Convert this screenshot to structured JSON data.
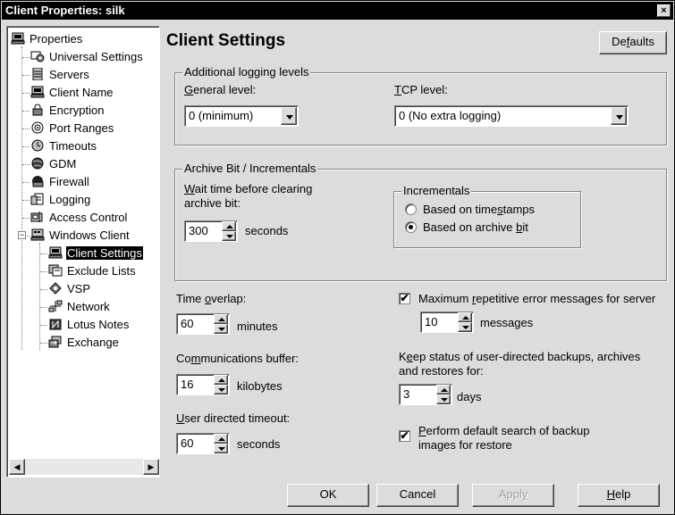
{
  "window": {
    "title": "Client Properties: silk",
    "close_glyph": "×"
  },
  "tree": {
    "root": {
      "label": "Properties",
      "icon": "computer-icon"
    },
    "items": [
      {
        "label": "Universal Settings",
        "icon": "gear-computer-icon"
      },
      {
        "label": "Servers",
        "icon": "server-icon"
      },
      {
        "label": "Client Name",
        "icon": "computer-icon"
      },
      {
        "label": "Encryption",
        "icon": "lock-icon"
      },
      {
        "label": "Port Ranges",
        "icon": "target-icon"
      },
      {
        "label": "Timeouts",
        "icon": "clock-icon"
      },
      {
        "label": "GDM",
        "icon": "globe-icon"
      },
      {
        "label": "Firewall",
        "icon": "firewall-icon"
      },
      {
        "label": "Logging",
        "icon": "log-icon"
      },
      {
        "label": "Access Control",
        "icon": "access-control-icon"
      },
      {
        "label": "Windows Client",
        "icon": "windows-client-icon",
        "expander": "−"
      }
    ],
    "children": [
      {
        "label": "Client Settings",
        "icon": "computer-icon",
        "selected": true
      },
      {
        "label": "Exclude Lists",
        "icon": "exclude-list-icon"
      },
      {
        "label": "VSP",
        "icon": "vsp-icon"
      },
      {
        "label": "Network",
        "icon": "network-icon"
      },
      {
        "label": "Lotus Notes",
        "icon": "lotus-notes-icon"
      },
      {
        "label": "Exchange",
        "icon": "exchange-icon"
      }
    ],
    "scroll_left": "◀",
    "scroll_right": "▶"
  },
  "panel": {
    "title": "Client Settings",
    "defaults_button": {
      "pre": "De",
      "key": "f",
      "post": "aults"
    },
    "logging": {
      "group_title": "Additional logging levels",
      "general_label": {
        "pre": "",
        "key": "G",
        "post": "eneral level:"
      },
      "general_value": "0  (minimum)",
      "tcp_label": {
        "pre": "",
        "key": "T",
        "post": "CP level:"
      },
      "tcp_value": "0 (No extra logging)"
    },
    "archive": {
      "group_title": "Archive Bit / Incrementals",
      "wait_label_line1": {
        "pre": "",
        "key": "W",
        "post": "ait time before clearing"
      },
      "wait_label_line2": "archive bit:",
      "wait_value": "300",
      "wait_unit": "seconds",
      "incrementals": {
        "title": "Incrementals",
        "options": [
          {
            "pre": "Based on time",
            "key": "s",
            "post": "tamps",
            "selected": false
          },
          {
            "pre": "Based on archive ",
            "key": "b",
            "post": "it",
            "selected": true
          }
        ]
      }
    },
    "time_overlap": {
      "label": {
        "pre": "Time ",
        "key": "o",
        "post": "verlap:"
      },
      "value": "60",
      "unit": "minutes"
    },
    "comm_buffer": {
      "label": {
        "pre": "Co",
        "key": "m",
        "post": "munications buffer:"
      },
      "value": "16",
      "unit": "kilobytes"
    },
    "user_timeout": {
      "label": {
        "pre": "",
        "key": "U",
        "post": "ser directed timeout:"
      },
      "value": "60",
      "unit": "seconds"
    },
    "max_errors": {
      "checked": true,
      "label": {
        "pre": "Maximum ",
        "key": "r",
        "post": "epetitive error messages for server"
      },
      "value": "10",
      "unit": "messages"
    },
    "keep_status": {
      "label_line1": {
        "pre": "K",
        "key": "e",
        "post": "ep status of user-directed backups, archives"
      },
      "label_line2": "and restores for:",
      "value": "3",
      "unit": "days"
    },
    "default_search": {
      "checked": true,
      "label_line1": {
        "pre": "",
        "key": "P",
        "post": "erform default search of backup"
      },
      "label_line2": "images for restore"
    }
  },
  "footer": {
    "ok": "OK",
    "cancel": "Cancel",
    "apply": {
      "pre": "Appl",
      "key": "y",
      "post": ""
    },
    "help": {
      "pre": "",
      "key": "H",
      "post": "elp"
    }
  },
  "checkmark": "✔"
}
